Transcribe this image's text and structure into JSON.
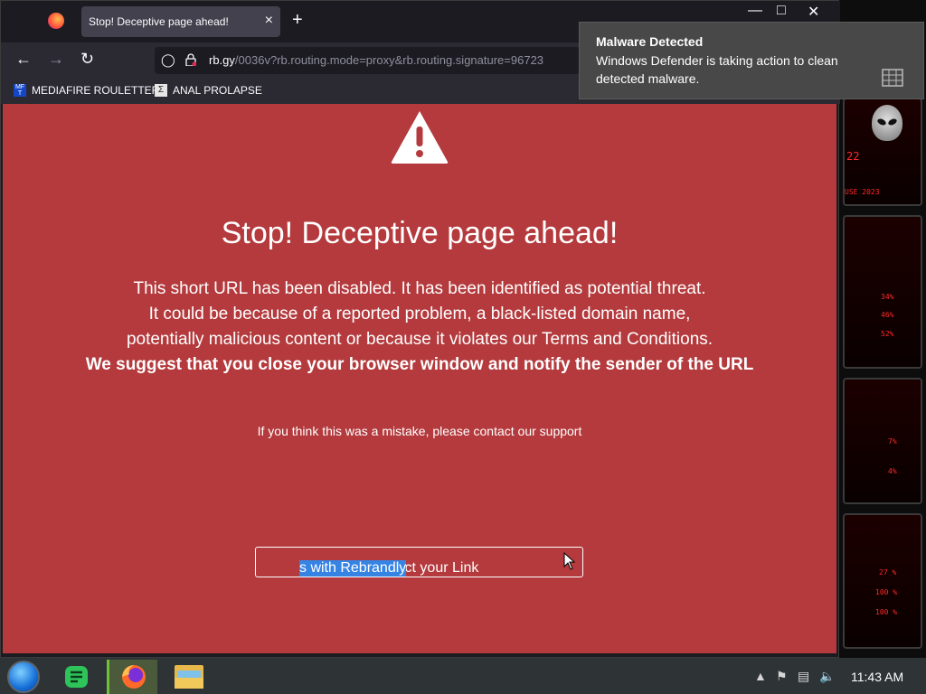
{
  "browser": {
    "tab_title": "Stop! Deceptive page ahead!",
    "tab_close": "×",
    "new_tab": "+",
    "url_host": "rb.gy",
    "url_path": "/0036v?rb.routing.mode=proxy&rb.routing.signature=96723",
    "bookmarks": [
      {
        "label": "MEDIAFIRE ROULETTER",
        "icon": "mediafire-icon"
      },
      {
        "label": "ANAL PROLAPSE",
        "icon": "sigma-icon"
      }
    ]
  },
  "page": {
    "headline": "Stop! Deceptive page ahead!",
    "lines": [
      "This short URL has been disabled. It has been identified as potential threat.",
      "It could be because of a reported problem, a black-listed domain name,",
      "potentially malicious content or because it violates our Terms and Conditions."
    ],
    "bold_line": "We suggest that you close your browser window and notify the sender of the URL",
    "support": "If you think this was a mistake, please contact our support",
    "rebrand_plain": "Brand and Protect your Link",
    "rebrand_selected": "s with Rebrandly"
  },
  "notification": {
    "title": "Malware Detected",
    "body": "Windows Defender is taking action to clean detected malware."
  },
  "taskbar": {
    "clock": "11:43 AM"
  },
  "desktop": {
    "stats": [
      "22",
      "USE 2023",
      "34%",
      "46%",
      "52%",
      "7%",
      "4%",
      "27 %",
      "100 %",
      "100 %"
    ]
  },
  "colors": {
    "page_bg": "#b43a3d",
    "selection": "#3584e4"
  }
}
